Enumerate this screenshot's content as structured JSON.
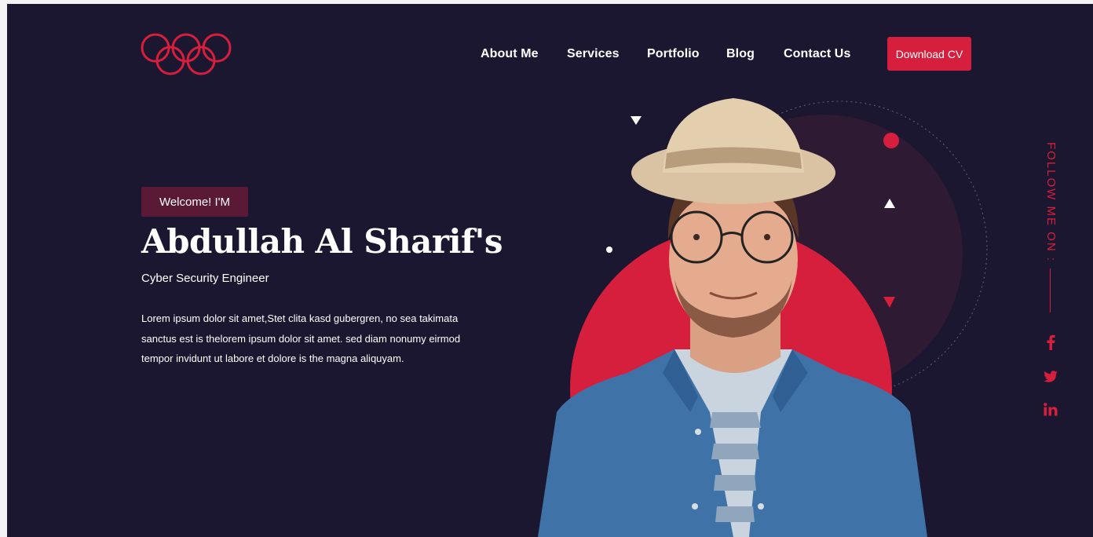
{
  "nav": {
    "items": [
      {
        "label": "About Me"
      },
      {
        "label": "Services"
      },
      {
        "label": "Portfolio"
      },
      {
        "label": "Blog"
      },
      {
        "label": "Contact Us"
      }
    ],
    "cta_label": "Download CV"
  },
  "hero": {
    "badge": "Welcome! I'M",
    "name": "Abdullah Al Sharif's",
    "role": "Cyber Security Engineer",
    "description": "Lorem ipsum dolor sit amet,Stet clita kasd gubergren, no sea takimata sanctus est is thelorem ipsum dolor sit amet. sed diam nonumy eirmod tempor invidunt ut labore et dolore is the magna aliquyam."
  },
  "sidebar": {
    "follow_label": "FOLLOW ME ON :",
    "socials": [
      {
        "icon": "facebook-icon"
      },
      {
        "icon": "twitter-icon"
      },
      {
        "icon": "linkedin-icon"
      }
    ]
  },
  "colors": {
    "background": "#1b1730",
    "accent": "#d61f3c",
    "badge": "#5a1a35",
    "text": "#ffffff"
  },
  "icons": {
    "logo": "rings-logo-icon"
  }
}
